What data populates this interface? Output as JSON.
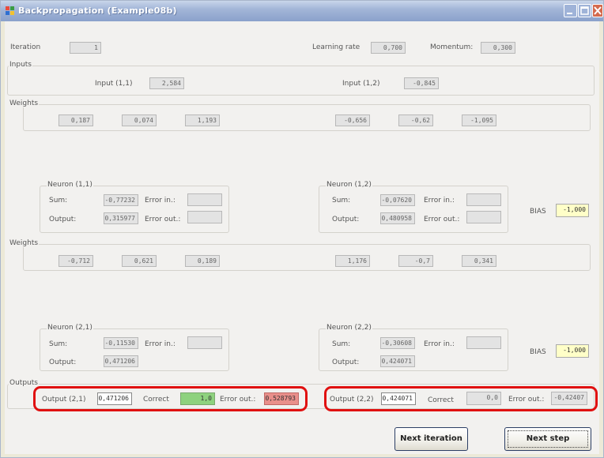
{
  "window": {
    "title": "Backpropagation (Example08b)"
  },
  "header": {
    "iteration_label": "Iteration",
    "iteration_value": "1",
    "learning_rate_label": "Learning rate",
    "learning_rate_value": "0,700",
    "momentum_label": "Momentum:",
    "momentum_value": "0,300"
  },
  "inputs": {
    "group_label": "Inputs",
    "input11_label": "Input (1,1)",
    "input11_value": "2,584",
    "input12_label": "Input (1,2)",
    "input12_value": "-0,845"
  },
  "weights1": {
    "group_label": "Weights",
    "values": [
      "0,187",
      "0,074",
      "1,193",
      "-0,656",
      "-0,62",
      "-1,095"
    ]
  },
  "neuron11": {
    "title": "Neuron (1,1)",
    "sum_label": "Sum:",
    "sum": "-0,77232",
    "output_label": "Output:",
    "output": "0,315977",
    "error_in_label": "Error in.:",
    "error_in": "",
    "error_out_label": "Error out.:",
    "error_out": ""
  },
  "neuron12": {
    "title": "Neuron (1,2)",
    "sum_label": "Sum:",
    "sum": "-0,07620",
    "output_label": "Output:",
    "output": "0,480958",
    "error_in_label": "Error in.:",
    "error_in": "",
    "error_out_label": "Error out.:",
    "error_out": ""
  },
  "bias1": {
    "label": "BIAS",
    "value": "-1,000"
  },
  "weights2": {
    "group_label": "Weights",
    "values": [
      "-0,712",
      "0,621",
      "0,189",
      "1,176",
      "-0,7",
      "0,341"
    ]
  },
  "neuron21": {
    "title": "Neuron (2,1)",
    "sum_label": "Sum:",
    "sum": "-0,11530",
    "output_label": "Output:",
    "output": "0,471206",
    "error_in_label": "Error in.:",
    "error_in": ""
  },
  "neuron22": {
    "title": "Neuron (2,2)",
    "sum_label": "Sum:",
    "sum": "-0,30608",
    "output_label": "Output:",
    "output": "0,424071",
    "error_in_label": "Error in.:",
    "error_in": ""
  },
  "bias2": {
    "label": "BIAS",
    "value": "-1,000"
  },
  "outputs": {
    "group_label": "Outputs",
    "out21_label": "Output (2,1)",
    "out21_value": "0,471206",
    "correct1_label": "Correct",
    "correct1_value": "1,0",
    "err1_label": "Error out.:",
    "err1_value": "0,528793",
    "out22_label": "Output (2,2)",
    "out22_value": "0,424071",
    "correct2_label": "Correct",
    "correct2_value": "0,0",
    "err2_label": "Error out.:",
    "err2_value": "-0,42407"
  },
  "buttons": {
    "next_iteration": "Next iteration",
    "next_step": "Next step"
  },
  "colors": {
    "highlight": "#e01010",
    "correct_ok": "#8ed27e",
    "error_bad": "#e98f8a",
    "bias": "#ffffc8"
  }
}
